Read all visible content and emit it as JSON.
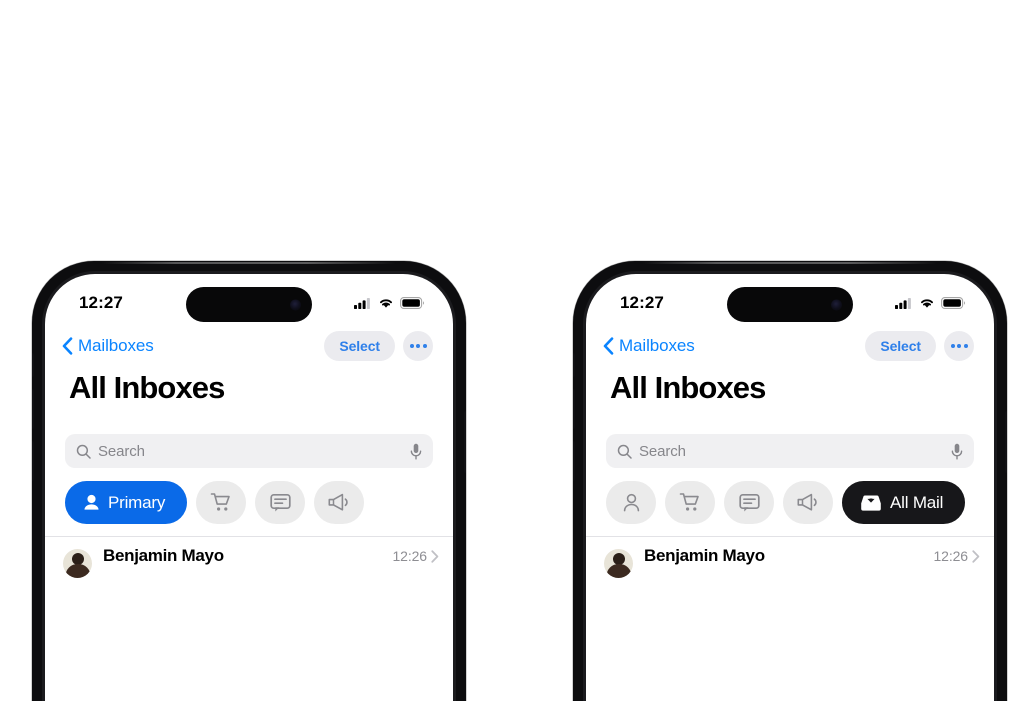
{
  "scene": {
    "background_color": "#ffffff",
    "description": "Two iPhone mockups side by side showing iOS Mail All Inboxes with filter chips"
  },
  "phones": [
    {
      "id": "left",
      "status_bar": {
        "time": "12:27",
        "cellular_icon": "cellular-bars-icon",
        "wifi_icon": "wifi-icon",
        "battery_icon": "battery-icon"
      },
      "nav_bar": {
        "back_icon": "chevron-left-icon",
        "back_label": "Mailboxes",
        "select_label": "Select",
        "more_icon": "ellipsis-icon"
      },
      "title": "All Inboxes",
      "search": {
        "placeholder": "Search",
        "value": "",
        "search_icon": "magnifier-icon",
        "mic_icon": "microphone-icon"
      },
      "chips": [
        {
          "label": "Primary",
          "icon": "person-fill-icon",
          "active": true,
          "style": "primary-active"
        },
        {
          "label": "",
          "icon": "cart-icon",
          "active": false,
          "style": "icon-only"
        },
        {
          "label": "",
          "icon": "chat-bubble-icon",
          "active": false,
          "style": "icon-only"
        },
        {
          "label": "",
          "icon": "megaphone-icon",
          "active": false,
          "style": "icon-only"
        }
      ],
      "mail_row": {
        "sender": "Benjamin Mayo",
        "time": "12:26",
        "chevron_icon": "chevron-right-icon",
        "avatar_icon": "avatar-photo"
      }
    },
    {
      "id": "right",
      "status_bar": {
        "time": "12:27",
        "cellular_icon": "cellular-bars-icon",
        "wifi_icon": "wifi-icon",
        "battery_icon": "battery-icon"
      },
      "nav_bar": {
        "back_icon": "chevron-left-icon",
        "back_label": "Mailboxes",
        "select_label": "Select",
        "more_icon": "ellipsis-icon"
      },
      "title": "All Inboxes",
      "search": {
        "placeholder": "Search",
        "value": "",
        "search_icon": "magnifier-icon",
        "mic_icon": "microphone-icon"
      },
      "chips": [
        {
          "label": "",
          "icon": "person-outline-icon",
          "active": false,
          "style": "icon-only"
        },
        {
          "label": "",
          "icon": "cart-icon",
          "active": false,
          "style": "icon-only"
        },
        {
          "label": "",
          "icon": "chat-bubble-icon",
          "active": false,
          "style": "icon-only"
        },
        {
          "label": "",
          "icon": "megaphone-icon",
          "active": false,
          "style": "icon-only"
        },
        {
          "label": "All Mail",
          "icon": "inbox-tray-icon",
          "active": true,
          "style": "allmail-active"
        }
      ],
      "mail_row": {
        "sender": "Benjamin Mayo",
        "time": "12:26",
        "chevron_icon": "chevron-right-icon",
        "avatar_icon": "avatar-photo"
      }
    }
  ],
  "colors": {
    "accent_blue": "#0a84ff",
    "chip_blue": "#0a6ae8",
    "chip_black": "#17171a",
    "chip_grey": "#ebebeb",
    "search_grey": "#f0f0f2",
    "nav_pill_grey": "#ebebef",
    "secondary_text": "#8e8e93",
    "frame_black": "#0d0d0f"
  }
}
